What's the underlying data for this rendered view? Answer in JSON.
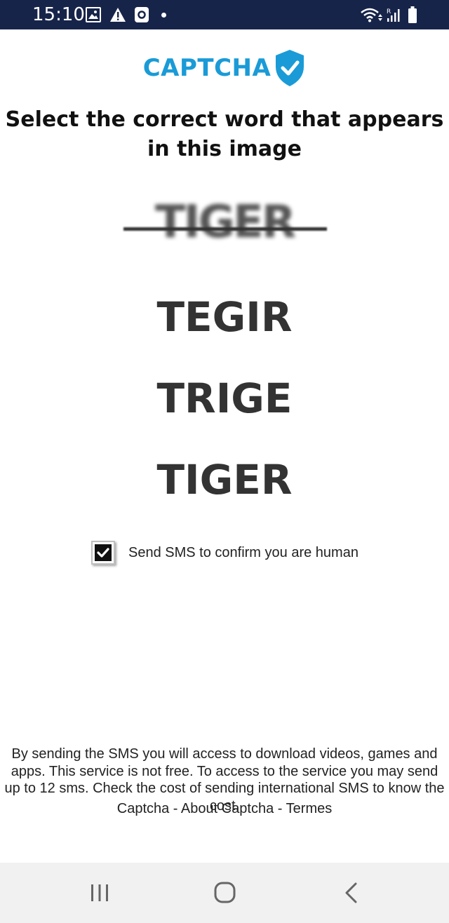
{
  "status_bar": {
    "time": "15:10",
    "icons": [
      "gallery-icon",
      "alert-icon",
      "app-icon",
      "dot-icon",
      "wifi-icon",
      "signal-icon",
      "battery-icon"
    ],
    "background_color": "#17244a"
  },
  "logo": {
    "text": "CAPTCHA",
    "color": "#1a9bd7",
    "icon": "shield-check-icon"
  },
  "heading": "Select the correct word that appears in this image",
  "captcha_image_text": "TIGER",
  "options": [
    "TEGIR",
    "TRIGE",
    "TIGER"
  ],
  "checkbox": {
    "checked": true,
    "label": "Send SMS to confirm you are human"
  },
  "disclaimer": "By sending the SMS you will access to download videos, games and apps. This service is not free. To access to the service you may send up to 12 sms. Check the cost of sending international SMS to know the cost.",
  "footer": {
    "link1": "Captcha",
    "sep1": " - ",
    "link2": "About Captcha",
    "sep2": " - ",
    "link3": "Termes"
  },
  "nav_bar": {
    "icons": [
      "recents-icon",
      "home-icon",
      "back-icon"
    ]
  }
}
